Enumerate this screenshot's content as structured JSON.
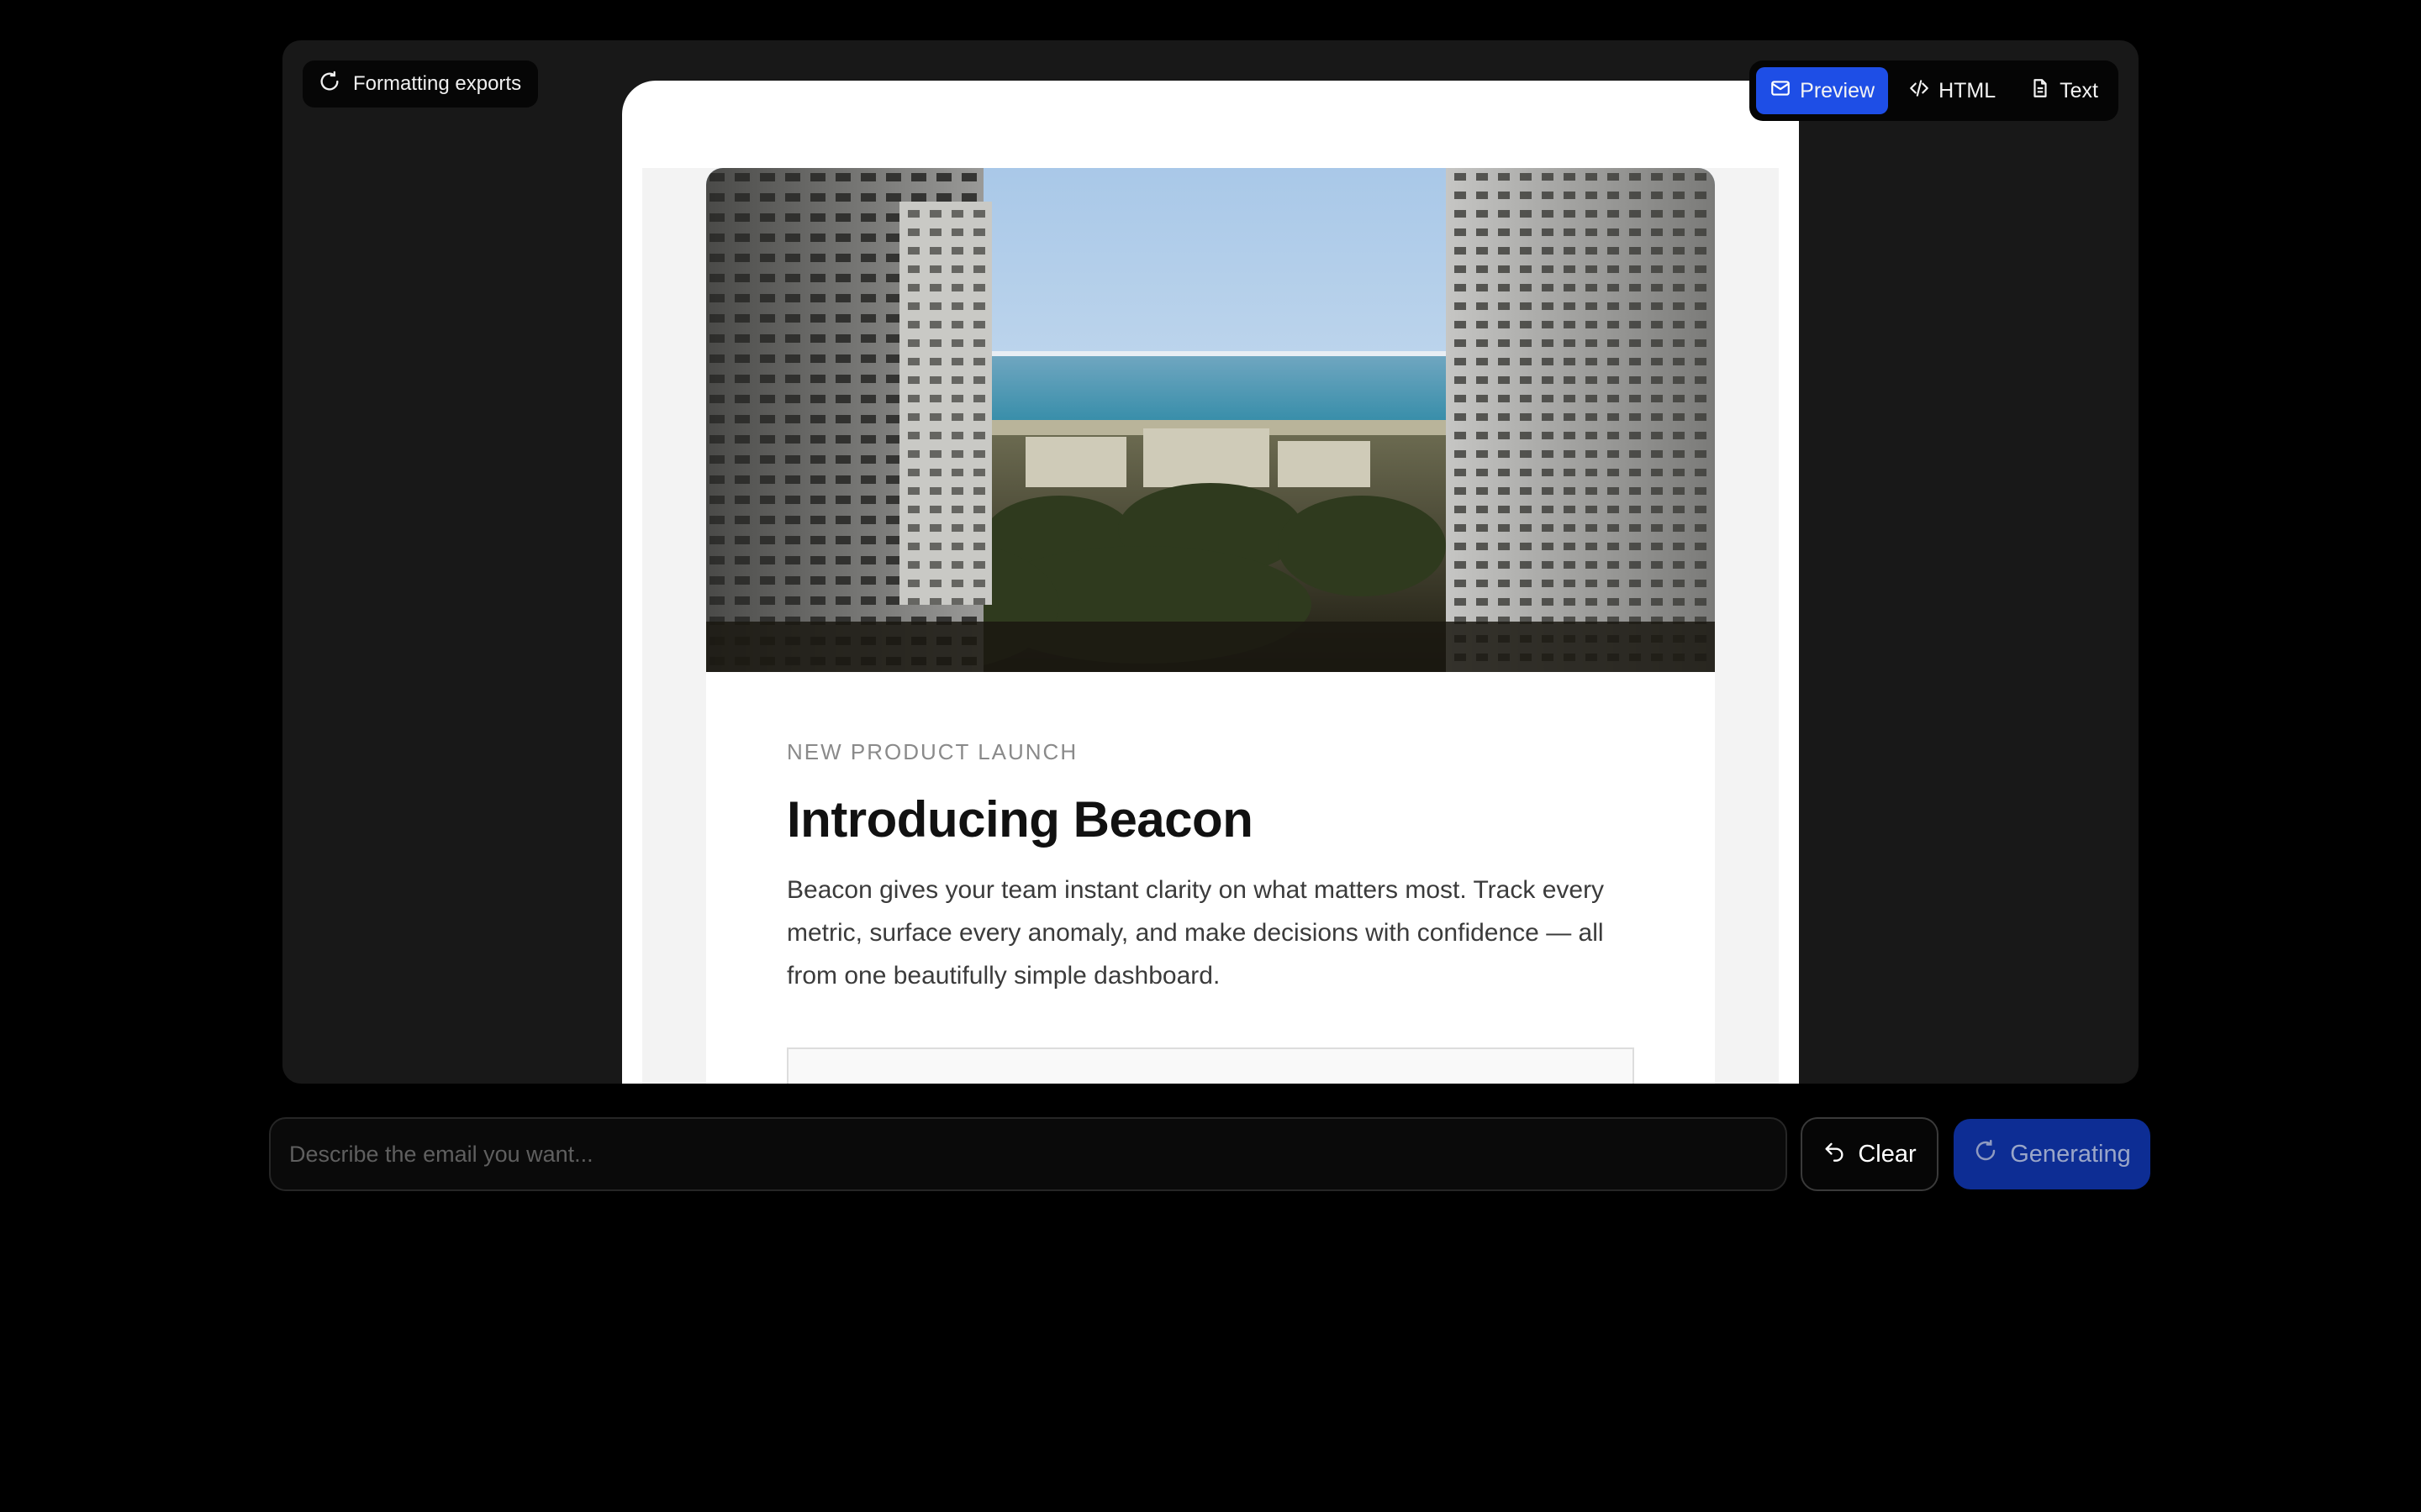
{
  "status": {
    "label": "Formatting exports",
    "icon": "loading-spinner-icon"
  },
  "view_toggle": {
    "items": [
      {
        "label": "Preview",
        "icon": "mail-icon",
        "active": true
      },
      {
        "label": "HTML",
        "icon": "code-icon",
        "active": false
      },
      {
        "label": "Text",
        "icon": "document-icon",
        "active": false
      }
    ],
    "active_color": "#1e4ee6"
  },
  "email": {
    "eyebrow": "NEW PRODUCT LAUNCH",
    "headline": "Introducing Beacon",
    "body": "Beacon gives your team instant clarity on what matters most. Track every metric, surface every anomaly, and make decisions with confidence — all from one beautifully simple dashboard."
  },
  "composer": {
    "placeholder": "Describe the email you want...",
    "value": ""
  },
  "actions": {
    "clear_label": "Clear",
    "generate_label": "Generating",
    "generate_color": "#0d2d94"
  }
}
